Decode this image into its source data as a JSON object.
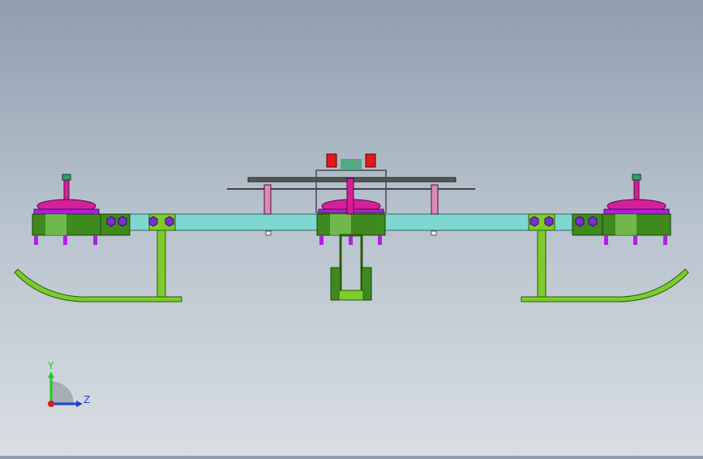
{
  "viewport": {
    "background_top": "#8e9eb0",
    "background_bottom": "#d9dee3"
  },
  "model": {
    "frame_color": "#7ed8d0",
    "skid_color": "#7ccc2a",
    "motor_color": "#3f8a1e",
    "mount_color": "#d61f9a",
    "bolt_color": "#7b2fd0",
    "board_color": "#595959",
    "esc_color": "#e11919",
    "prop_color": "#1a1a1a",
    "items": [
      "left-motor",
      "right-motor",
      "center-motor",
      "flight-controller",
      "left-skid",
      "right-skid",
      "camera-mount"
    ]
  },
  "triad": {
    "y_label": "Y",
    "z_label": "Z",
    "y_color": "#1fcc1f",
    "z_color": "#1b3fd6",
    "x_color": "#e11919"
  }
}
